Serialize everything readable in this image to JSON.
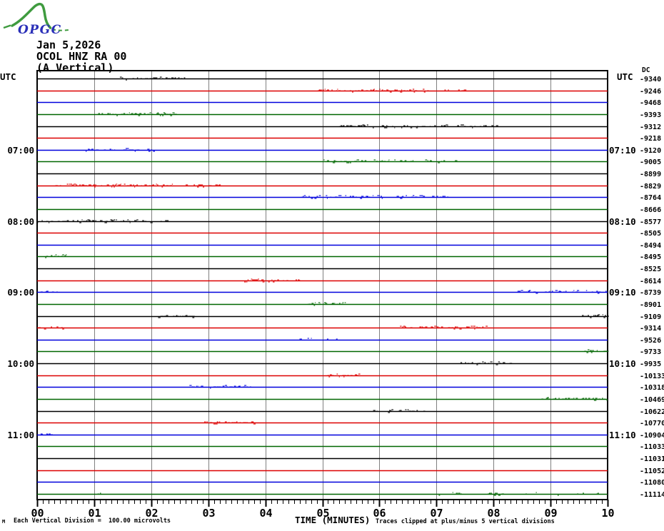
{
  "logo": {
    "text": "OPGC",
    "green": "#3f9b3f",
    "blue": "#2a2fb8"
  },
  "header": {
    "date": "Jan 5,2026",
    "station": "OCOL HNZ RA 00",
    "component": "(A Vertical)"
  },
  "axis": {
    "utc_left": "UTC",
    "utc_right": "UTC",
    "dc_header": "DC",
    "x_tick_labels": [
      "00",
      "01",
      "02",
      "03",
      "04",
      "05",
      "06",
      "07",
      "08",
      "09",
      "10"
    ],
    "x_axis_label": "TIME (MINUTES)"
  },
  "footer": {
    "mark": "M",
    "scale_note": "Each Vertical Division =  100.00 microvolts",
    "clip_note": "Traces clipped at plus/minus 5 vertical divisions"
  },
  "colors": {
    "trace_cycle": [
      "#000000",
      "#dd0000",
      "#0000dd",
      "#006600"
    ],
    "grid": "#808080",
    "border": "#000000",
    "background": "#ffffff"
  },
  "chart_data": {
    "type": "line",
    "subtype": "helicorder-seismogram",
    "title": "OCOL HNZ RA 00 (A Vertical) - Jan 5,2026",
    "x_label": "TIME (MINUTES)",
    "x_range_minutes": [
      0,
      10
    ],
    "minutes_per_row": 10,
    "grid": "vertical gray line at each minute",
    "left_time_labels": [
      "07:00",
      "08:00",
      "09:00",
      "10:00",
      "11:00"
    ],
    "right_time_labels": [
      "07:10",
      "08:10",
      "09:10",
      "10:10",
      "11:10"
    ],
    "rows": [
      {
        "dc": "-9340",
        "bursts": [
          [
            1.45,
            2.6,
            0.5
          ]
        ]
      },
      {
        "dc": "-9246",
        "bursts": [
          [
            4.9,
            6.7,
            0.55
          ],
          [
            6.7,
            7.5,
            0.15
          ]
        ]
      },
      {
        "dc": "-9468",
        "bursts": []
      },
      {
        "dc": "-9393",
        "bursts": [
          [
            1.05,
            2.45,
            0.5
          ]
        ]
      },
      {
        "dc": "-9312",
        "bursts": [
          [
            5.3,
            8.1,
            0.4
          ]
        ]
      },
      {
        "dc": "-9218",
        "bursts": []
      },
      {
        "dc": "-9120",
        "left": "07:00",
        "right": "07:10",
        "bursts": [
          [
            0.85,
            2.1,
            0.45
          ]
        ]
      },
      {
        "dc": "-9005",
        "bursts": [
          [
            5.0,
            7.6,
            0.35
          ]
        ]
      },
      {
        "dc": "-8899",
        "bursts": []
      },
      {
        "dc": "-8829",
        "bursts": [
          [
            0.3,
            3.2,
            0.45
          ]
        ]
      },
      {
        "dc": "-8764",
        "bursts": [
          [
            4.6,
            7.3,
            0.4
          ]
        ]
      },
      {
        "dc": "-8666",
        "bursts": []
      },
      {
        "dc": "-8577",
        "left": "08:00",
        "right": "08:10",
        "bursts": [
          [
            0.0,
            2.3,
            0.45
          ]
        ]
      },
      {
        "dc": "-8505",
        "bursts": []
      },
      {
        "dc": "-8494",
        "bursts": []
      },
      {
        "dc": "-8495",
        "bursts": [
          [
            0.1,
            0.55,
            0.3
          ]
        ]
      },
      {
        "dc": "-8525",
        "bursts": []
      },
      {
        "dc": "-8614",
        "bursts": [
          [
            3.55,
            4.6,
            0.4
          ]
        ]
      },
      {
        "dc": "-8739",
        "left": "09:00",
        "right": "09:10",
        "bursts": [
          [
            0.0,
            0.4,
            0.35
          ],
          [
            8.4,
            10.0,
            0.45
          ]
        ]
      },
      {
        "dc": "-8901",
        "bursts": [
          [
            4.75,
            5.45,
            0.4
          ]
        ]
      },
      {
        "dc": "-9109",
        "bursts": [
          [
            2.1,
            2.8,
            0.45
          ],
          [
            9.55,
            10.0,
            0.5
          ]
        ]
      },
      {
        "dc": "-9314",
        "bursts": [
          [
            0.0,
            0.45,
            0.3
          ],
          [
            6.3,
            7.9,
            0.4
          ]
        ]
      },
      {
        "dc": "-9526",
        "bursts": [
          [
            4.6,
            5.25,
            0.35
          ]
        ]
      },
      {
        "dc": "-9733",
        "bursts": [
          [
            9.55,
            10.0,
            0.5
          ]
        ]
      },
      {
        "dc": "-9935",
        "left": "10:00",
        "right": "10:10",
        "bursts": [
          [
            7.3,
            8.4,
            0.45
          ]
        ]
      },
      {
        "dc": "-10133",
        "bursts": [
          [
            5.05,
            5.65,
            0.4
          ]
        ]
      },
      {
        "dc": "-10318",
        "bursts": [
          [
            2.65,
            3.75,
            0.45
          ]
        ]
      },
      {
        "dc": "-10469",
        "bursts": [
          [
            8.8,
            10.0,
            0.4
          ]
        ]
      },
      {
        "dc": "-10622",
        "bursts": [
          [
            5.85,
            6.85,
            0.45
          ]
        ]
      },
      {
        "dc": "-10770",
        "bursts": [
          [
            2.85,
            3.8,
            0.45
          ]
        ]
      },
      {
        "dc": "-10904",
        "left": "11:00",
        "right": "11:10",
        "bursts": [
          [
            0.0,
            0.35,
            0.3
          ]
        ]
      },
      {
        "dc": "-11033",
        "bursts": []
      },
      {
        "dc": "-11031",
        "bursts": []
      },
      {
        "dc": "-11052",
        "bursts": []
      },
      {
        "dc": "-11080",
        "bursts": []
      },
      {
        "dc": "-11114",
        "bursts": [
          [
            1.0,
            1.15,
            0.3
          ],
          [
            6.9,
            10.0,
            0.12
          ]
        ]
      }
    ]
  }
}
